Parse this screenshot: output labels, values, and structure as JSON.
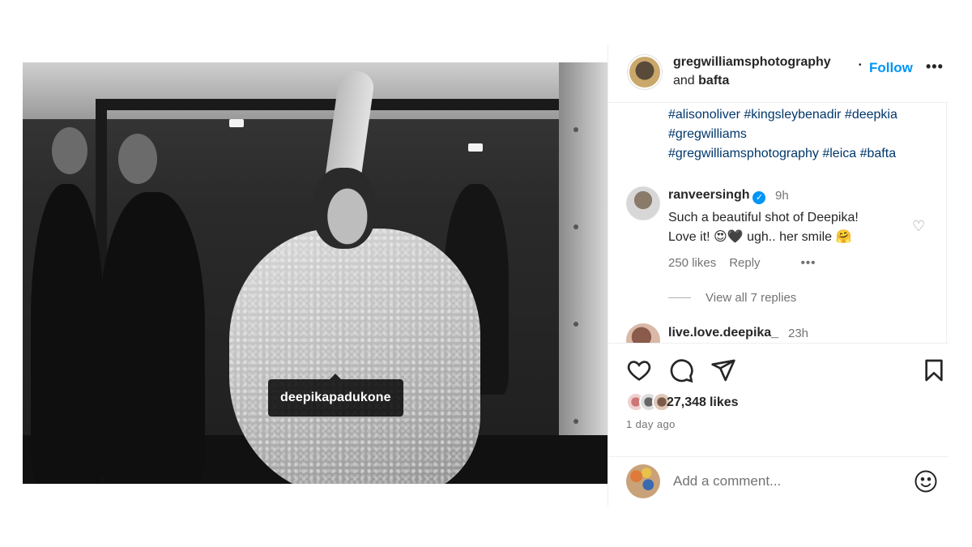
{
  "post": {
    "tagged_user": "deepikapadukone",
    "carousel": {
      "count": 6,
      "active_index": 5
    }
  },
  "header": {
    "author": "gregwilliamsphotography",
    "and_text": "and",
    "coauthor": "bafta",
    "separator": "•",
    "follow_label": "Follow",
    "more_label": "•••"
  },
  "caption": {
    "hashtags": [
      "#alisonoliver",
      "#kingsleybenadir",
      "#deepkia",
      "#gregwilliams",
      "#gregwilliamsphotography",
      "#leica",
      "#bafta"
    ]
  },
  "comments": [
    {
      "username": "ranveersingh",
      "verified": true,
      "time": "9h",
      "line1": "Such a beautiful shot of Deepika!",
      "line2": "Love it! 😍🖤 ugh.. her smile 🤗",
      "likes": "250 likes",
      "reply_label": "Reply",
      "options_label": "•••",
      "view_replies": "View all 7 replies"
    },
    {
      "username": "live.love.deepika_",
      "time": "23h"
    }
  ],
  "actions": {
    "like_icon": "heart-icon",
    "comment_icon": "comment-bubble-icon",
    "share_icon": "paper-plane-icon",
    "save_icon": "bookmark-icon"
  },
  "likes": {
    "count": "27,348",
    "word": "likes"
  },
  "posted_ago": "1 day ago",
  "add_comment": {
    "placeholder": "Add a comment...",
    "emoji_icon": "smiley-icon"
  },
  "colors": {
    "link_blue": "#0095f6",
    "hashtag": "#00376b",
    "muted": "#737373",
    "text": "#262626"
  }
}
